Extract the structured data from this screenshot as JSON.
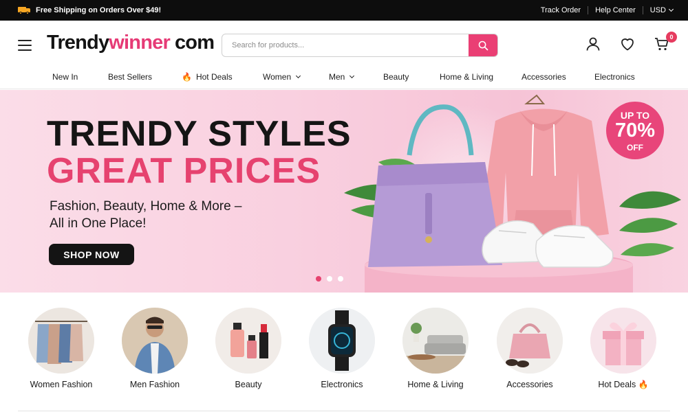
{
  "topbar": {
    "shipping_text": "Free Shipping on Orders Over $49!",
    "links": [
      "Track Order",
      "Help Center"
    ],
    "currency": "USD"
  },
  "header": {
    "logo_part1": "Trendy",
    "logo_part2": "winner",
    "logo_part3": "com",
    "search_placeholder": "Search for products...",
    "cart_count": "0"
  },
  "nav": {
    "items": [
      "New In",
      "Best Sellers",
      "Hot Deals",
      "Women",
      "Men",
      "Beauty",
      "Home & Living",
      "Accessories",
      "Electronics"
    ]
  },
  "hero": {
    "headline_line1": "TRENDY STYLES",
    "headline_line2": "GREAT PRICES",
    "subtitle_line1": "Fashion, Beauty, Home & More –",
    "subtitle_line2": "All in One Place!",
    "cta": "SHOP NOW",
    "promo_line1": "UP TO",
    "promo_line2": "70%",
    "promo_line3": "OFF",
    "slides_total": 3,
    "slide_active": 1
  },
  "categories": [
    "Women Fashion",
    "Men Fashion",
    "Beauty",
    "Electronics",
    "Home & Living",
    "Accessories",
    "Hot Deals"
  ],
  "colors": {
    "accent": "#e6426f",
    "topbar_bg": "#0d0d0d",
    "hero_bg": "#f9cfdf"
  }
}
